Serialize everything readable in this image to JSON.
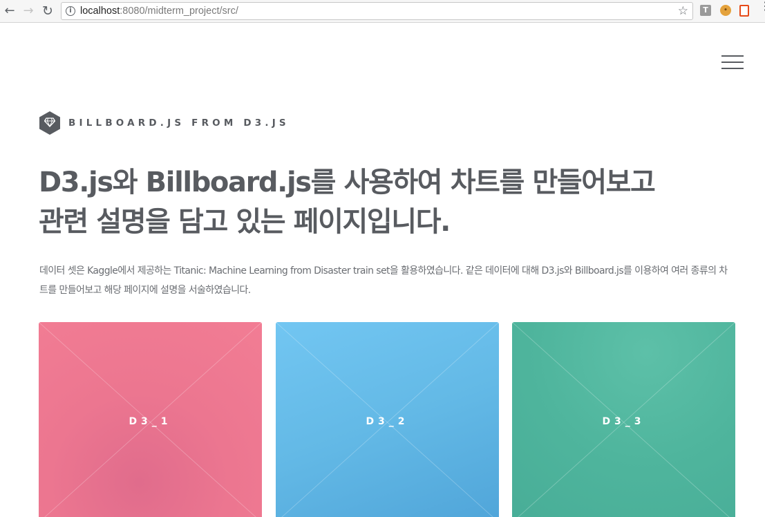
{
  "browser": {
    "url_host": "localhost",
    "url_path": ":8080/midterm_project/src/",
    "extensions": [
      "T",
      "cookie",
      "office"
    ]
  },
  "site": {
    "brand": "BILLBOARD.JS FROM D3.JS",
    "headline_line1": "D3.js와 Billboard.js를 사용하여 차트를 만들어보고",
    "headline_line2": "관련 설명을 담고 있는 페이지입니다.",
    "description": "데이터 셋은 Kaggle에서 제공하는 Titanic: Machine Learning from Disaster train set을 활용하였습니다. 같은 데이터에 대해 D3.js와 Billboard.js를 이용하여 여러 종류의 차트를 만들어보고 해당 페이지에 설명을 서술하였습니다."
  },
  "tiles": [
    {
      "label": "D3_1",
      "color": "#ec7690"
    },
    {
      "label": "D3_2",
      "color": "#63b9e6"
    },
    {
      "label": "D3_3",
      "color": "#4fb59d"
    }
  ],
  "icons": {
    "back": "arrow-left-icon",
    "forward": "arrow-right-icon",
    "reload": "reload-icon",
    "info": "info-icon",
    "bookmark": "star-icon",
    "menu": "hamburger-icon",
    "logo": "diamond-icon"
  }
}
